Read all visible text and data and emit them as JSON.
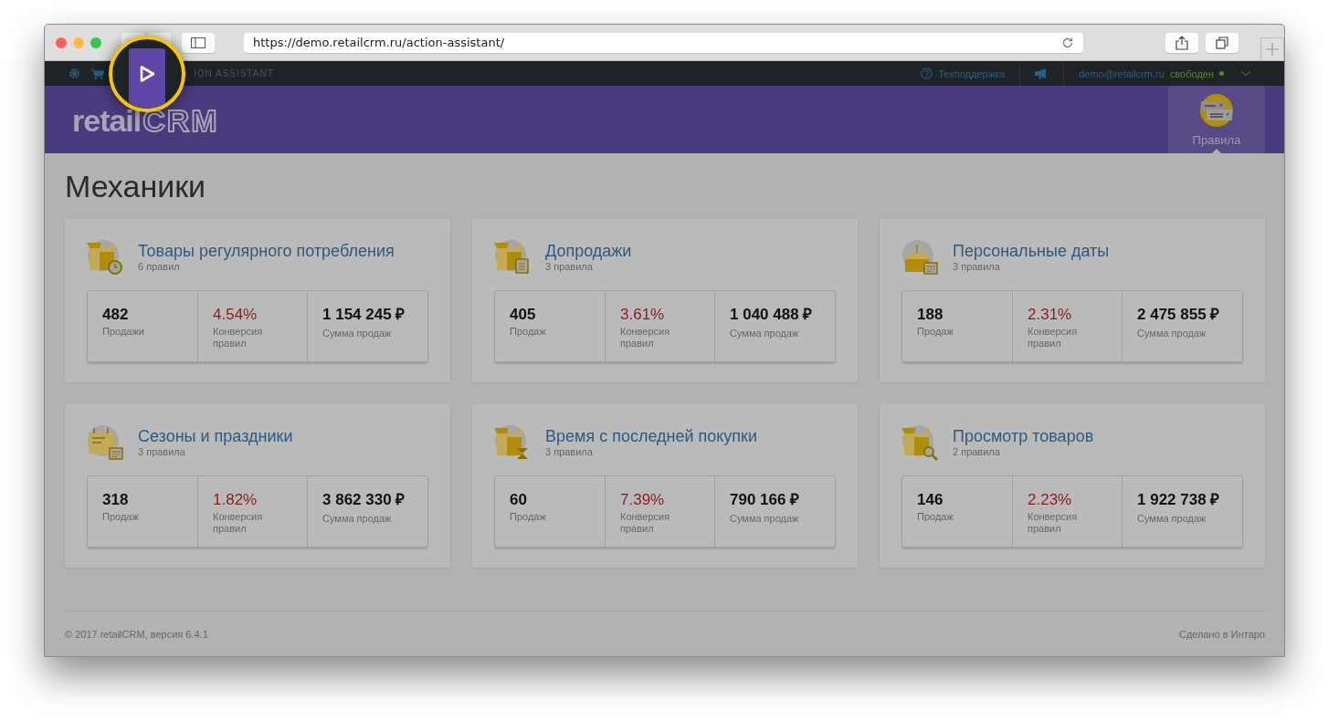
{
  "browser": {
    "url": "https://demo.retailcrm.ru/action-assistant/"
  },
  "topbar": {
    "app_label": "ION ASSISTANT",
    "support": "Техподдержка",
    "user_email": "demo@retailcrm.ru",
    "user_status": "свободен",
    "online": true
  },
  "header": {
    "logo_left": "retail",
    "logo_right": "CRM",
    "nav": [
      {
        "label": "Правила",
        "selected": true
      }
    ]
  },
  "page_title": "Механики",
  "cards": [
    {
      "title": "Товары регулярного потребления",
      "subtitle": "6 правил",
      "stats": [
        {
          "value": "482",
          "label": "Продажи",
          "kind": "count"
        },
        {
          "value": "4.54%",
          "label": "Конверсия правил",
          "kind": "percent"
        },
        {
          "value": "1 154 245 ₽",
          "label": "Сумма продаж",
          "kind": "sum"
        }
      ]
    },
    {
      "title": "Допродажи",
      "subtitle": "3 правила",
      "stats": [
        {
          "value": "405",
          "label": "Продаж",
          "kind": "count"
        },
        {
          "value": "3.61%",
          "label": "Конверсия правил",
          "kind": "percent"
        },
        {
          "value": "1 040 488 ₽",
          "label": "Сумма продаж",
          "kind": "sum"
        }
      ]
    },
    {
      "title": "Персональные даты",
      "subtitle": "3 правила",
      "stats": [
        {
          "value": "188",
          "label": "Продаж",
          "kind": "count"
        },
        {
          "value": "2.31%",
          "label": "Конверсия правил",
          "kind": "percent"
        },
        {
          "value": "2 475 855 ₽",
          "label": "Сумма продаж",
          "kind": "sum"
        }
      ]
    },
    {
      "title": "Сезоны и праздники",
      "subtitle": "3 правила",
      "stats": [
        {
          "value": "318",
          "label": "Продаж",
          "kind": "count"
        },
        {
          "value": "1.82%",
          "label": "Конверсия правил",
          "kind": "percent"
        },
        {
          "value": "3 862 330 ₽",
          "label": "Сумма продаж",
          "kind": "sum"
        }
      ]
    },
    {
      "title": "Время с последней покупки",
      "subtitle": "3 правила",
      "stats": [
        {
          "value": "60",
          "label": "Продаж",
          "kind": "count"
        },
        {
          "value": "7.39%",
          "label": "Конверсия правил",
          "kind": "percent"
        },
        {
          "value": "790 166 ₽",
          "label": "Сумма продаж",
          "kind": "sum"
        }
      ]
    },
    {
      "title": "Просмотр товаров",
      "subtitle": "2 правила",
      "stats": [
        {
          "value": "146",
          "label": "Продаж",
          "kind": "count"
        },
        {
          "value": "2.23%",
          "label": "Конверсия правил",
          "kind": "percent"
        },
        {
          "value": "1 922 738 ₽",
          "label": "Сумма продаж",
          "kind": "sum"
        }
      ]
    }
  ],
  "footer": {
    "copyright": "© 2017 retailCRM, версия 6.4.1",
    "credit": "Сделано в Интаро"
  }
}
